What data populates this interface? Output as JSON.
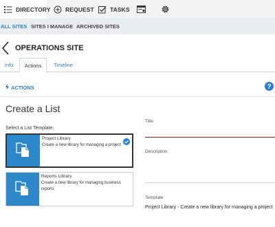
{
  "topnav": {
    "directory_label": "DIRECTORY",
    "request_label": "REQUEST",
    "tasks_label": "TASKS"
  },
  "subnav": {
    "items": [
      "ALL SITES",
      "SITES I MANAGE",
      "ARCHIVED SITES"
    ],
    "active": "ALL SITES"
  },
  "site": {
    "title": "OPERATIONS SITE"
  },
  "tabs": [
    "Info",
    "Actions",
    "Timeline"
  ],
  "active_tab": "Actions",
  "actions": {
    "label": "ACTIONS"
  },
  "create_list": {
    "title": "Create a List",
    "select_label": "Select a List Template:",
    "templates": [
      {
        "name": "Project Library",
        "description": "Create a new library for managing a project",
        "selected": true
      },
      {
        "name": "Reports Library",
        "description": "Create a new library for managing business reports",
        "selected": false
      }
    ]
  },
  "form": {
    "title_label": "Title",
    "title_value": "",
    "description_label": "Description",
    "description_value": "",
    "template_label": "Template",
    "template_value": "Project Library - Create a new library for managing a project"
  },
  "colors": {
    "accent": "#2b7fd4",
    "thumb_blue": "#2d88c9",
    "error_underline": "#a11a1a",
    "topnav_bg": "#f2f2f2",
    "subnav_bg": "#e9edf0"
  },
  "icons": [
    "list-icon",
    "plus-circle-icon",
    "checkbox-icon",
    "task-tray-icon",
    "gear-icon",
    "chevron-left-icon",
    "lightning-icon",
    "help-icon",
    "document-icon",
    "check-circle-icon"
  ]
}
